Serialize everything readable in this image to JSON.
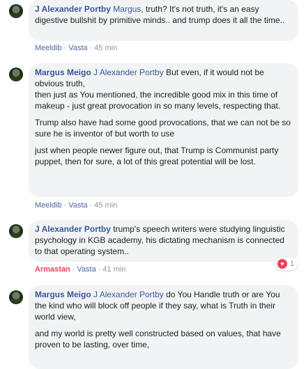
{
  "comments": [
    {
      "author": "J Alexander Portby",
      "mention": "Margus,",
      "paragraphs": [
        "truth? It's not truth, it's an easy digestive bullshit by primitive minds.. and trump does it all the time.."
      ],
      "action_like": "Meeldib",
      "action_reply": "Vasta",
      "time": "45 min"
    },
    {
      "author": "Margus Meigo",
      "mention": "J Alexander Portby",
      "paragraphs": [
        "But even, if it would not be obvious truth,\nthen just as You mentioned, the incredible good mix in this time of makeup - just great provocation in so many levels, respecting that.",
        "Trump also have had some good provocations, that we can not be so sure he is inventor of but worth to use",
        "just when people newer figure out, that Trump is Communist party puppet, then for sure, a lot of this great potential will be lost."
      ],
      "action_like": "Meeldib",
      "action_reply": "Vasta",
      "time": "45 min"
    },
    {
      "author": "J Alexander Portby",
      "mention": "",
      "paragraphs": [
        "trump's speech writers were studying linguistic psychology in KGB academy, his dictating mechanism is connected to that operating system.."
      ],
      "action_like": "Armastan",
      "action_reply": "Vasta",
      "time": "41 min",
      "reaction_count": "1"
    },
    {
      "author": "Margus Meigo",
      "mention": "J Alexander Portby",
      "paragraphs": [
        "do You Handle truth or are You the kind who will block off people if they say, what is Truth in their world view,",
        "and my world is pretty well constructed based on values, that have proven to be lasting, over time,"
      ]
    }
  ]
}
